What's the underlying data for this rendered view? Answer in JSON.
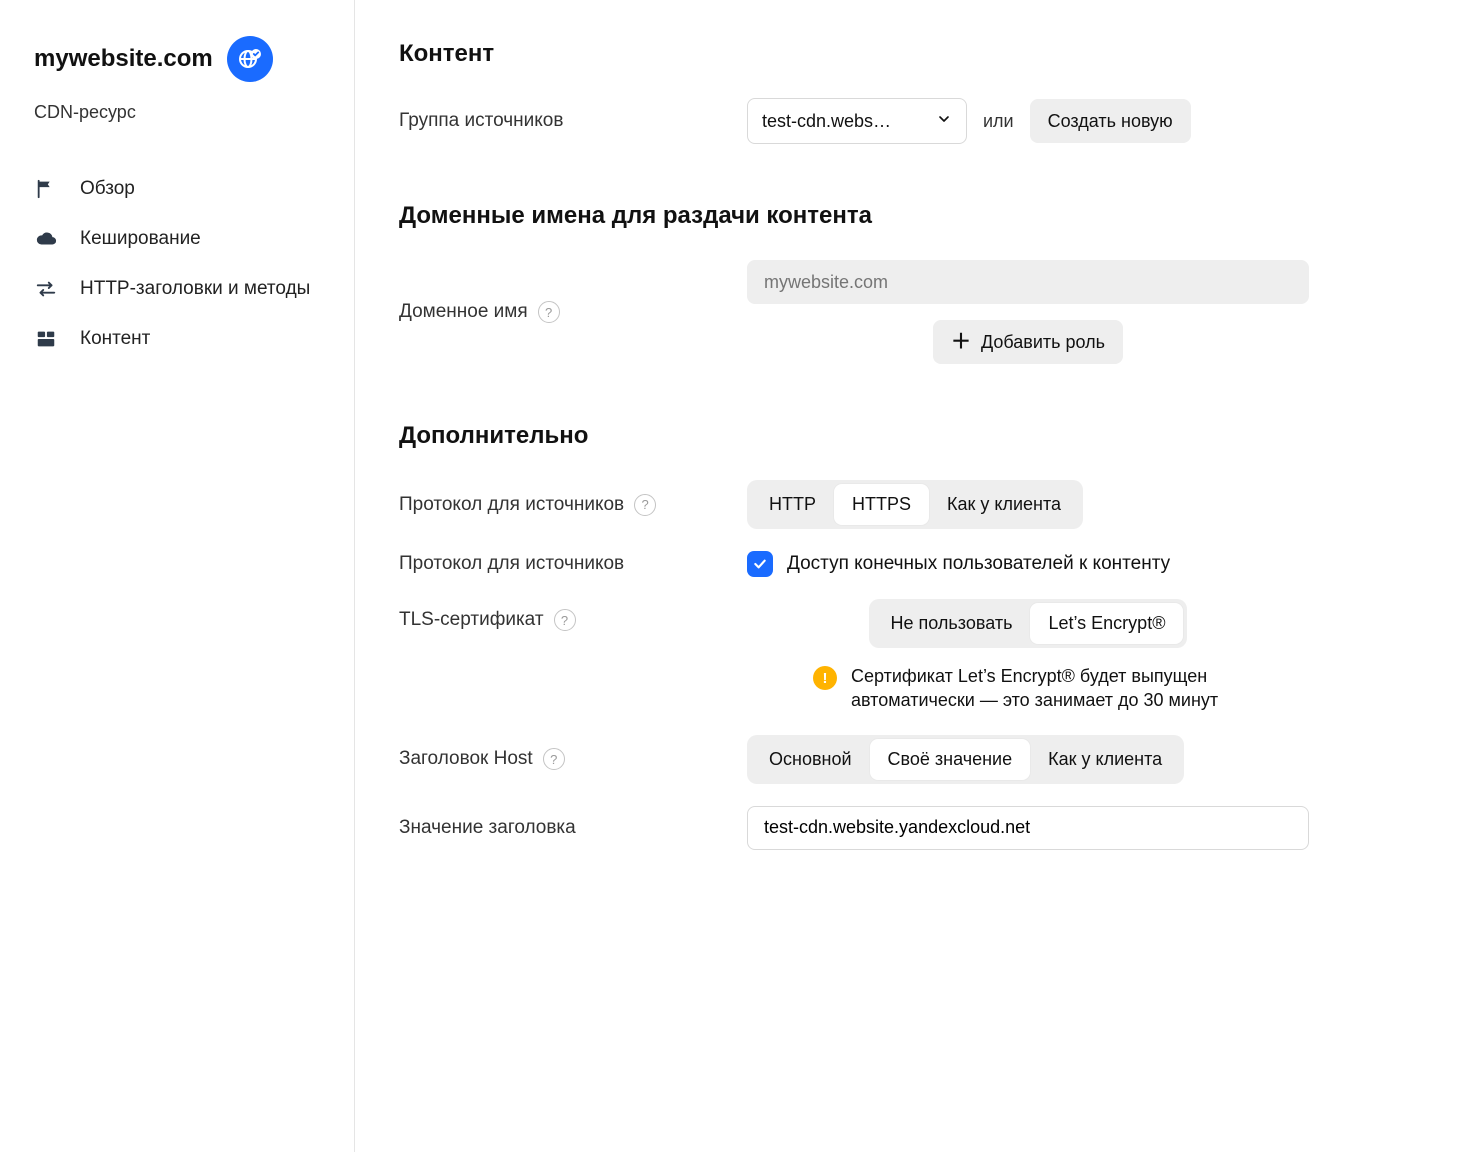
{
  "sidebar": {
    "title": "mywebsite.com",
    "subtitle": "CDN-ресурс",
    "items": [
      {
        "label": "Обзор"
      },
      {
        "label": "Кеширование"
      },
      {
        "label": "HTTP-заголовки и методы"
      },
      {
        "label": "Контент"
      }
    ]
  },
  "sections": {
    "content": {
      "heading": "Контент",
      "origin_group_label": "Группа источников",
      "origin_group_value": "test-cdn.webs…",
      "or": "или",
      "create_new": "Создать новую"
    },
    "domains": {
      "heading": "Доменные имена для раздачи контента",
      "domain_label": "Доменное имя",
      "domain_placeholder": "mywebsite.com",
      "add_role": "Добавить роль"
    },
    "extra": {
      "heading": "Дополнительно",
      "proto_src_label": "Протокол для источников",
      "proto_options": [
        "HTTP",
        "HTTPS",
        "Как у клиента"
      ],
      "proto_selected_index": 1,
      "access_row_label": "Протокол для источников",
      "access_checkbox_label": "Доступ конечных пользователей к контенту",
      "tls_label": "TLS-сертификат",
      "tls_options": [
        "Не пользовать",
        "Let’s Encrypt®"
      ],
      "tls_selected_index": 1,
      "tls_notice": "Сертификат Let’s Encrypt® будет выпущен автоматически — это занимает до 30 минут",
      "host_label": "Заголовок Host",
      "host_options": [
        "Основной",
        "Своё значение",
        "Как у клиента"
      ],
      "host_selected_index": 1,
      "header_value_label": "Значение заголовка",
      "header_value": "test-cdn.website.yandexcloud.net"
    }
  },
  "glyphs": {
    "help": "?",
    "warn": "!"
  }
}
